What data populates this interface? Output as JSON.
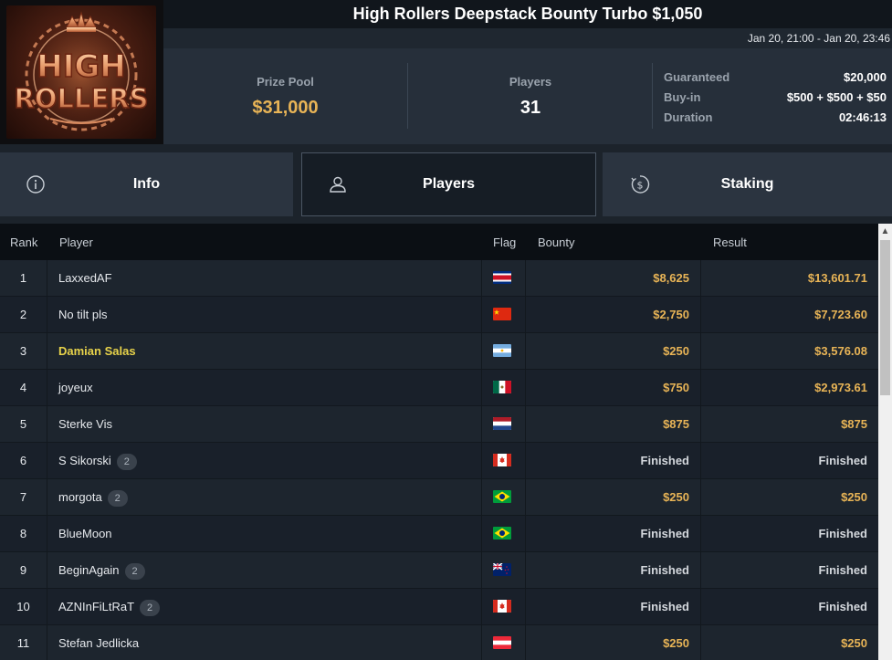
{
  "tournament": {
    "title": "High Rollers Deepstack Bounty Turbo $1,050",
    "dates": "Jan 20, 21:00 - Jan 20, 23:46",
    "logo_text": "HIGH ROLLERS"
  },
  "stats": {
    "prize_pool_label": "Prize Pool",
    "prize_pool_value": "$31,000",
    "players_label": "Players",
    "players_value": "31",
    "guaranteed_label": "Guaranteed",
    "guaranteed_value": "$20,000",
    "buyin_label": "Buy-in",
    "buyin_value": "$500 + $500 + $50",
    "duration_label": "Duration",
    "duration_value": "02:46:13"
  },
  "tabs": [
    {
      "label": "Info",
      "icon": "info-icon"
    },
    {
      "label": "Players",
      "icon": "user-icon",
      "active": true
    },
    {
      "label": "Staking",
      "icon": "dollar-coin-icon"
    }
  ],
  "table": {
    "headers": {
      "rank": "Rank",
      "player": "Player",
      "flag": "Flag",
      "bounty": "Bounty",
      "result": "Result"
    },
    "rows": [
      {
        "rank": "1",
        "player": "LaxxedAF",
        "flag": "costa-rica",
        "bounty": "$8,625",
        "result": "$13,601.71"
      },
      {
        "rank": "2",
        "player": "No tilt pls",
        "flag": "china",
        "bounty": "$2,750",
        "result": "$7,723.60"
      },
      {
        "rank": "3",
        "player": "Damian Salas",
        "flag": "argentina",
        "bounty": "$250",
        "result": "$3,576.08",
        "highlight": true
      },
      {
        "rank": "4",
        "player": "joyeux",
        "flag": "mexico",
        "bounty": "$750",
        "result": "$2,973.61"
      },
      {
        "rank": "5",
        "player": "Sterke Vis",
        "flag": "netherlands",
        "bounty": "$875",
        "result": "$875"
      },
      {
        "rank": "6",
        "player": "S Sikorski",
        "badge": "2",
        "flag": "canada",
        "bounty": "Finished",
        "result": "Finished"
      },
      {
        "rank": "7",
        "player": "morgota",
        "badge": "2",
        "flag": "brazil",
        "bounty": "$250",
        "result": "$250"
      },
      {
        "rank": "8",
        "player": "BlueMoon",
        "flag": "brazil",
        "bounty": "Finished",
        "result": "Finished"
      },
      {
        "rank": "9",
        "player": "BeginAgain",
        "badge": "2",
        "flag": "new-zealand",
        "bounty": "Finished",
        "result": "Finished"
      },
      {
        "rank": "10",
        "player": "AZNInFiLtRaT",
        "badge": "2",
        "flag": "canada",
        "bounty": "Finished",
        "result": "Finished"
      },
      {
        "rank": "11",
        "player": "Stefan Jedlicka",
        "flag": "austria",
        "bounty": "$250",
        "result": "$250"
      }
    ]
  },
  "colors": {
    "gold": "#e8b456",
    "highlight": "#e8d34a",
    "background": "#1c232b"
  }
}
